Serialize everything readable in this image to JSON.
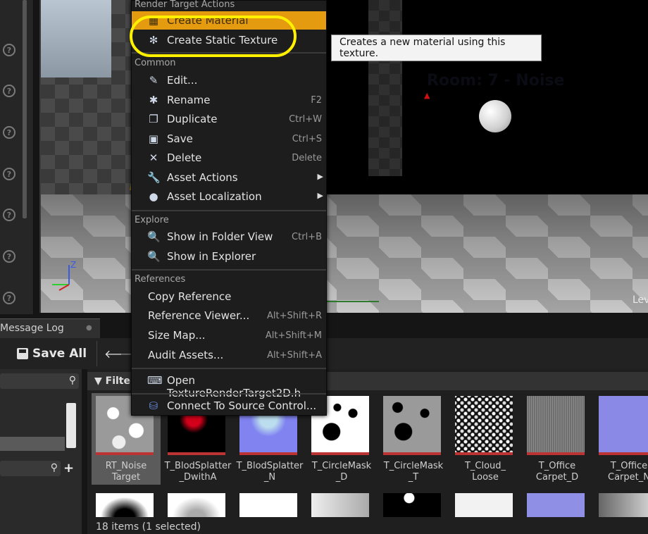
{
  "message_log": {
    "label": "Message Log"
  },
  "toolbar": {
    "save_all": "Save All"
  },
  "viewport": {
    "overlay_text": "Room: 7 - Noise",
    "corner_text": "Lev",
    "axis_z": "Z"
  },
  "filters": {
    "label": "Filters"
  },
  "context_menu": {
    "header": "Render Target Actions",
    "render_target_items": [
      {
        "label": "Create Material",
        "icon": "material-icon",
        "highlighted": true
      },
      {
        "label": "Create Static Texture",
        "icon": "texture-icon"
      }
    ],
    "common_header": "Common",
    "common_items": [
      {
        "label": "Edit...",
        "shortcut": "",
        "icon": "edit-icon"
      },
      {
        "label": "Rename",
        "shortcut": "F2",
        "icon": "rename-icon"
      },
      {
        "label": "Duplicate",
        "shortcut": "Ctrl+W",
        "icon": "duplicate-icon"
      },
      {
        "label": "Save",
        "shortcut": "Ctrl+S",
        "icon": "save-icon"
      },
      {
        "label": "Delete",
        "shortcut": "Delete",
        "icon": "delete-icon"
      },
      {
        "label": "Asset Actions",
        "shortcut": "",
        "icon": "wrench-icon",
        "submenu": true
      },
      {
        "label": "Asset Localization",
        "shortcut": "",
        "icon": "globe-icon",
        "submenu": true
      }
    ],
    "explore_header": "Explore",
    "explore_items": [
      {
        "label": "Show in Folder View",
        "shortcut": "Ctrl+B",
        "icon": "magnifier-icon"
      },
      {
        "label": "Show in Explorer",
        "shortcut": "",
        "icon": "magnifier-icon"
      }
    ],
    "references_header": "References",
    "reference_items": [
      {
        "label": "Copy Reference",
        "shortcut": ""
      },
      {
        "label": "Reference Viewer...",
        "shortcut": "Alt+Shift+R"
      },
      {
        "label": "Size Map...",
        "shortcut": "Alt+Shift+M"
      },
      {
        "label": "Audit Assets...",
        "shortcut": "Alt+Shift+A"
      }
    ],
    "open_item": {
      "label": "Open TextureRenderTarget2D.h",
      "icon": "code-icon"
    },
    "source_control_item": {
      "label": "Connect To Source Control...",
      "icon": "source-control-icon"
    }
  },
  "tooltip": {
    "text": "Creates a new material using this texture."
  },
  "assets": [
    {
      "label": "RT_Noise\nTarget",
      "selected": true
    },
    {
      "label": "T_BlodSplatter\n_DwithA"
    },
    {
      "label": "T_BlodSplatter\n_N"
    },
    {
      "label": "T_CircleMask\n_D"
    },
    {
      "label": "T_CircleMask\n_T"
    },
    {
      "label": "T_Cloud_\nLoose"
    },
    {
      "label": "T_Office\nCarpet_D"
    },
    {
      "label": "T_Office\nCarpet_N"
    }
  ],
  "status": {
    "items_text": "18 items (1 selected)"
  }
}
